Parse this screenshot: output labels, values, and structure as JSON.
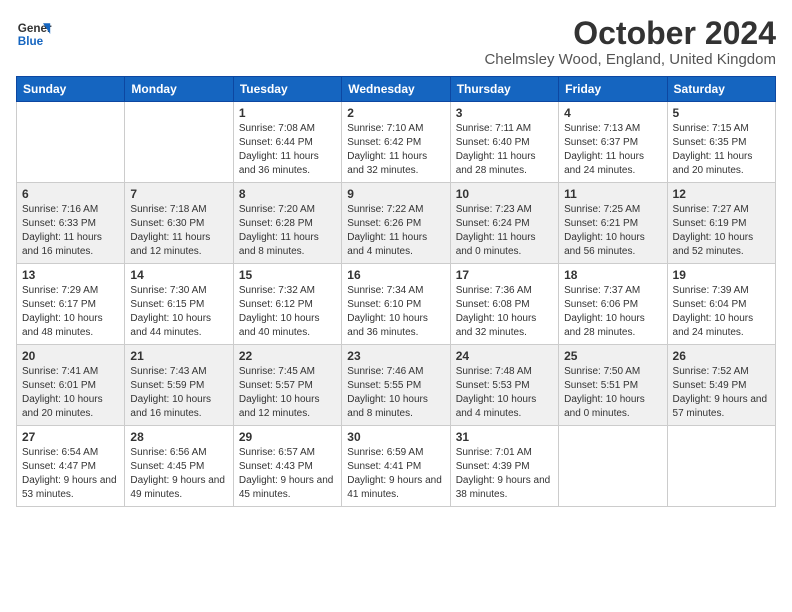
{
  "logo": {
    "line1": "General",
    "line2": "Blue"
  },
  "title": "October 2024",
  "location": "Chelmsley Wood, England, United Kingdom",
  "headers": [
    "Sunday",
    "Monday",
    "Tuesday",
    "Wednesday",
    "Thursday",
    "Friday",
    "Saturday"
  ],
  "weeks": [
    [
      {
        "day": "",
        "info": ""
      },
      {
        "day": "",
        "info": ""
      },
      {
        "day": "1",
        "info": "Sunrise: 7:08 AM\nSunset: 6:44 PM\nDaylight: 11 hours and 36 minutes."
      },
      {
        "day": "2",
        "info": "Sunrise: 7:10 AM\nSunset: 6:42 PM\nDaylight: 11 hours and 32 minutes."
      },
      {
        "day": "3",
        "info": "Sunrise: 7:11 AM\nSunset: 6:40 PM\nDaylight: 11 hours and 28 minutes."
      },
      {
        "day": "4",
        "info": "Sunrise: 7:13 AM\nSunset: 6:37 PM\nDaylight: 11 hours and 24 minutes."
      },
      {
        "day": "5",
        "info": "Sunrise: 7:15 AM\nSunset: 6:35 PM\nDaylight: 11 hours and 20 minutes."
      }
    ],
    [
      {
        "day": "6",
        "info": "Sunrise: 7:16 AM\nSunset: 6:33 PM\nDaylight: 11 hours and 16 minutes."
      },
      {
        "day": "7",
        "info": "Sunrise: 7:18 AM\nSunset: 6:30 PM\nDaylight: 11 hours and 12 minutes."
      },
      {
        "day": "8",
        "info": "Sunrise: 7:20 AM\nSunset: 6:28 PM\nDaylight: 11 hours and 8 minutes."
      },
      {
        "day": "9",
        "info": "Sunrise: 7:22 AM\nSunset: 6:26 PM\nDaylight: 11 hours and 4 minutes."
      },
      {
        "day": "10",
        "info": "Sunrise: 7:23 AM\nSunset: 6:24 PM\nDaylight: 11 hours and 0 minutes."
      },
      {
        "day": "11",
        "info": "Sunrise: 7:25 AM\nSunset: 6:21 PM\nDaylight: 10 hours and 56 minutes."
      },
      {
        "day": "12",
        "info": "Sunrise: 7:27 AM\nSunset: 6:19 PM\nDaylight: 10 hours and 52 minutes."
      }
    ],
    [
      {
        "day": "13",
        "info": "Sunrise: 7:29 AM\nSunset: 6:17 PM\nDaylight: 10 hours and 48 minutes."
      },
      {
        "day": "14",
        "info": "Sunrise: 7:30 AM\nSunset: 6:15 PM\nDaylight: 10 hours and 44 minutes."
      },
      {
        "day": "15",
        "info": "Sunrise: 7:32 AM\nSunset: 6:12 PM\nDaylight: 10 hours and 40 minutes."
      },
      {
        "day": "16",
        "info": "Sunrise: 7:34 AM\nSunset: 6:10 PM\nDaylight: 10 hours and 36 minutes."
      },
      {
        "day": "17",
        "info": "Sunrise: 7:36 AM\nSunset: 6:08 PM\nDaylight: 10 hours and 32 minutes."
      },
      {
        "day": "18",
        "info": "Sunrise: 7:37 AM\nSunset: 6:06 PM\nDaylight: 10 hours and 28 minutes."
      },
      {
        "day": "19",
        "info": "Sunrise: 7:39 AM\nSunset: 6:04 PM\nDaylight: 10 hours and 24 minutes."
      }
    ],
    [
      {
        "day": "20",
        "info": "Sunrise: 7:41 AM\nSunset: 6:01 PM\nDaylight: 10 hours and 20 minutes."
      },
      {
        "day": "21",
        "info": "Sunrise: 7:43 AM\nSunset: 5:59 PM\nDaylight: 10 hours and 16 minutes."
      },
      {
        "day": "22",
        "info": "Sunrise: 7:45 AM\nSunset: 5:57 PM\nDaylight: 10 hours and 12 minutes."
      },
      {
        "day": "23",
        "info": "Sunrise: 7:46 AM\nSunset: 5:55 PM\nDaylight: 10 hours and 8 minutes."
      },
      {
        "day": "24",
        "info": "Sunrise: 7:48 AM\nSunset: 5:53 PM\nDaylight: 10 hours and 4 minutes."
      },
      {
        "day": "25",
        "info": "Sunrise: 7:50 AM\nSunset: 5:51 PM\nDaylight: 10 hours and 0 minutes."
      },
      {
        "day": "26",
        "info": "Sunrise: 7:52 AM\nSunset: 5:49 PM\nDaylight: 9 hours and 57 minutes."
      }
    ],
    [
      {
        "day": "27",
        "info": "Sunrise: 6:54 AM\nSunset: 4:47 PM\nDaylight: 9 hours and 53 minutes."
      },
      {
        "day": "28",
        "info": "Sunrise: 6:56 AM\nSunset: 4:45 PM\nDaylight: 9 hours and 49 minutes."
      },
      {
        "day": "29",
        "info": "Sunrise: 6:57 AM\nSunset: 4:43 PM\nDaylight: 9 hours and 45 minutes."
      },
      {
        "day": "30",
        "info": "Sunrise: 6:59 AM\nSunset: 4:41 PM\nDaylight: 9 hours and 41 minutes."
      },
      {
        "day": "31",
        "info": "Sunrise: 7:01 AM\nSunset: 4:39 PM\nDaylight: 9 hours and 38 minutes."
      },
      {
        "day": "",
        "info": ""
      },
      {
        "day": "",
        "info": ""
      }
    ]
  ]
}
